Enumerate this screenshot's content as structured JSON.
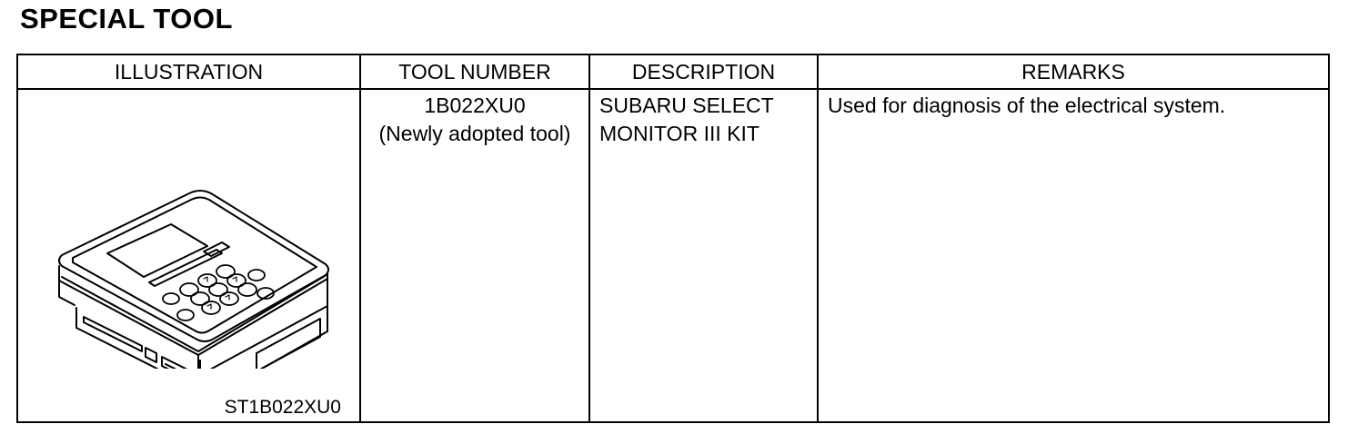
{
  "page_title": "SPECIAL TOOL",
  "table": {
    "headers": {
      "illustration": "ILLUSTRATION",
      "tool_number": "TOOL NUMBER",
      "description": "DESCRIPTION",
      "remarks": "REMARKS"
    },
    "rows": [
      {
        "illustration_code": "ST1B022XU0",
        "tool_number": "1B022XU0",
        "tool_note": "(Newly adopted tool)",
        "description_line1": "SUBARU SELECT",
        "description_line2": "MONITOR III KIT",
        "remarks": "Used for diagnosis of the electrical system."
      }
    ]
  }
}
